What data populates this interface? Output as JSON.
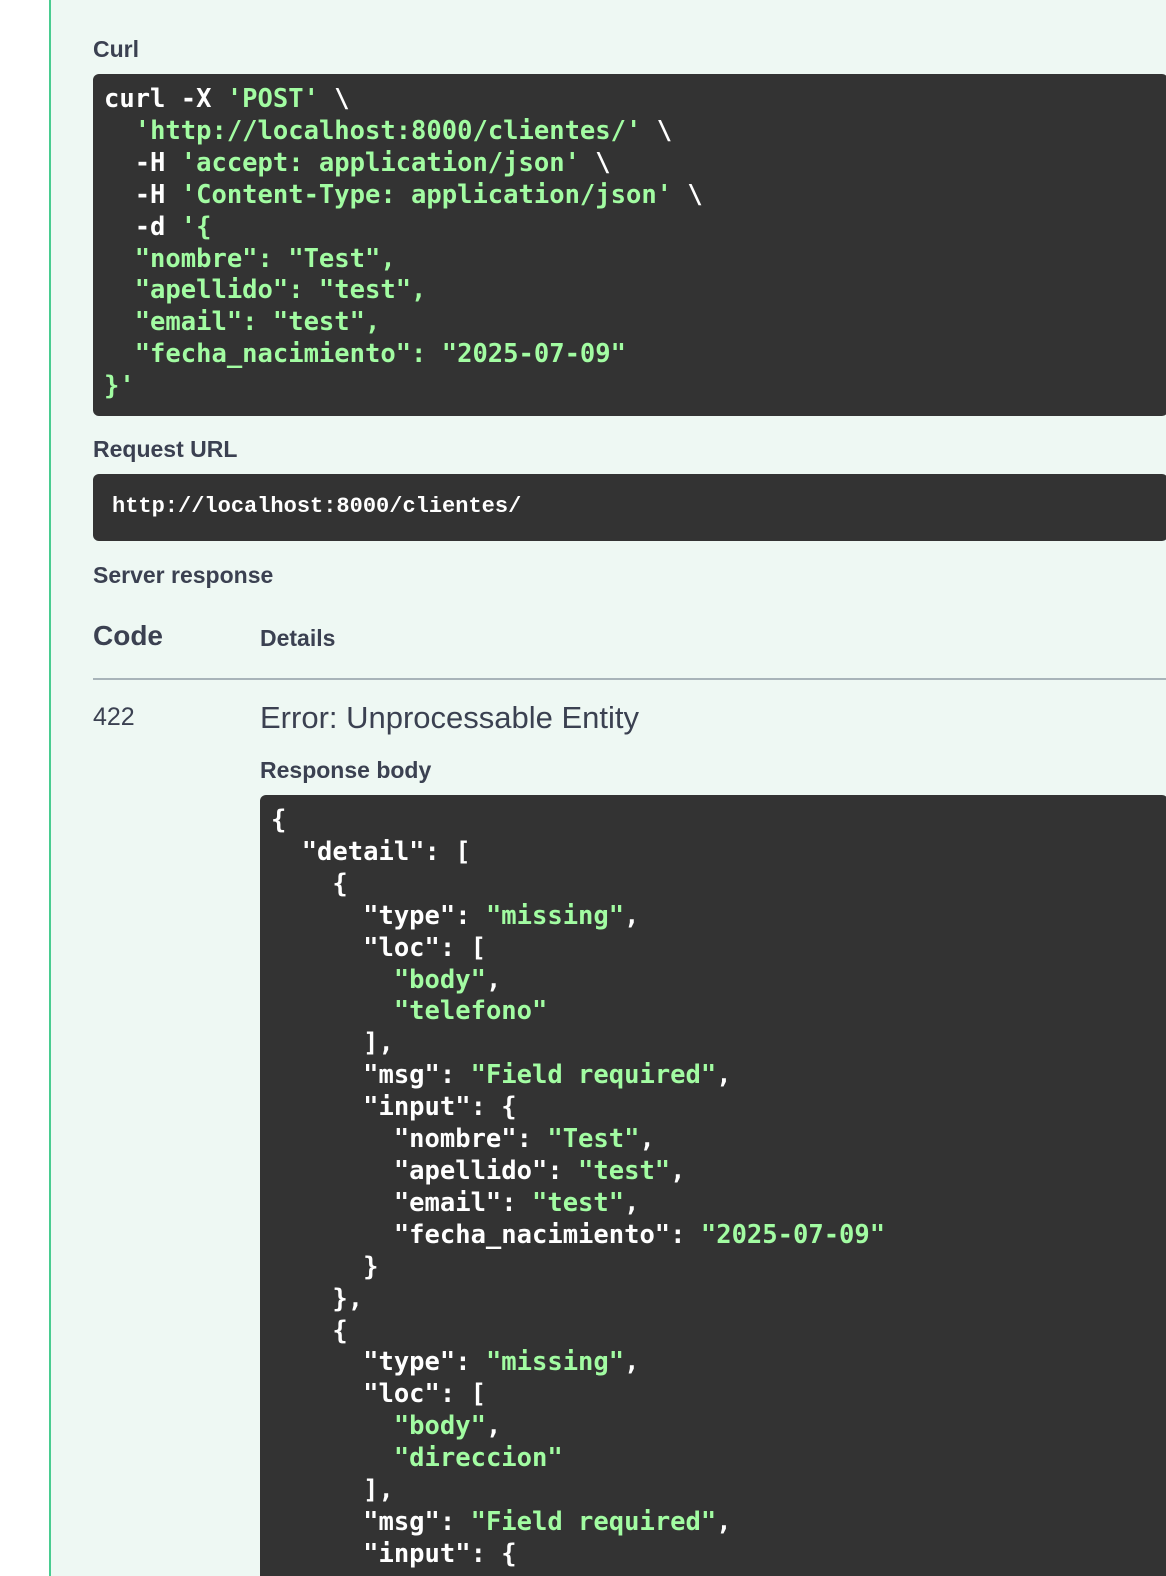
{
  "sections": {
    "curl_label": "Curl",
    "request_url_label": "Request URL",
    "server_response_label": "Server response"
  },
  "curl": {
    "lines": [
      [
        "curl -X ",
        {
          "s": "'POST'"
        },
        " \\"
      ],
      [
        "  ",
        {
          "s": "'http://localhost:8000/clientes/'"
        },
        " \\"
      ],
      [
        "  -H ",
        {
          "s": "'accept: application/json'"
        },
        " \\"
      ],
      [
        "  -H ",
        {
          "s": "'Content-Type: application/json'"
        },
        " \\"
      ],
      [
        "  -d ",
        {
          "s": "'{"
        }
      ],
      [
        {
          "s": "  \"nombre\": \"Test\","
        }
      ],
      [
        {
          "s": "  \"apellido\": \"test\","
        }
      ],
      [
        {
          "s": "  \"email\": \"test\","
        }
      ],
      [
        {
          "s": "  \"fecha_nacimiento\": \"2025-07-09\""
        }
      ],
      [
        {
          "s": "}'"
        }
      ]
    ]
  },
  "request_url": "http://localhost:8000/clientes/",
  "response_table": {
    "code_header": "Code",
    "details_header": "Details",
    "code": "422",
    "title": "Error: Unprocessable Entity",
    "body_label": "Response body"
  },
  "response_body": {
    "lines": [
      [
        "{"
      ],
      [
        "  \"detail\": ["
      ],
      [
        "    {"
      ],
      [
        "      \"type\": ",
        {
          "s": "\"missing\""
        },
        ","
      ],
      [
        "      \"loc\": ["
      ],
      [
        "        ",
        {
          "s": "\"body\""
        },
        ","
      ],
      [
        "        ",
        {
          "s": "\"telefono\""
        }
      ],
      [
        "      ],"
      ],
      [
        "      \"msg\": ",
        {
          "s": "\"Field required\""
        },
        ","
      ],
      [
        "      \"input\": {"
      ],
      [
        "        \"nombre\": ",
        {
          "s": "\"Test\""
        },
        ","
      ],
      [
        "        \"apellido\": ",
        {
          "s": "\"test\""
        },
        ","
      ],
      [
        "        \"email\": ",
        {
          "s": "\"test\""
        },
        ","
      ],
      [
        "        \"fecha_nacimiento\": ",
        {
          "s": "\"2025-07-09\""
        }
      ],
      [
        "      }"
      ],
      [
        "    },"
      ],
      [
        "    {"
      ],
      [
        "      \"type\": ",
        {
          "s": "\"missing\""
        },
        ","
      ],
      [
        "      \"loc\": ["
      ],
      [
        "        ",
        {
          "s": "\"body\""
        },
        ","
      ],
      [
        "        ",
        {
          "s": "\"direccion\""
        }
      ],
      [
        "      ],"
      ],
      [
        "      \"msg\": ",
        {
          "s": "\"Field required\""
        },
        ","
      ],
      [
        "      \"input\": {"
      ]
    ]
  },
  "colors": {
    "panel_bg": "#eef8f3",
    "accent": "#49cc90",
    "code_bg": "#333333",
    "string": "#a2fca2"
  }
}
